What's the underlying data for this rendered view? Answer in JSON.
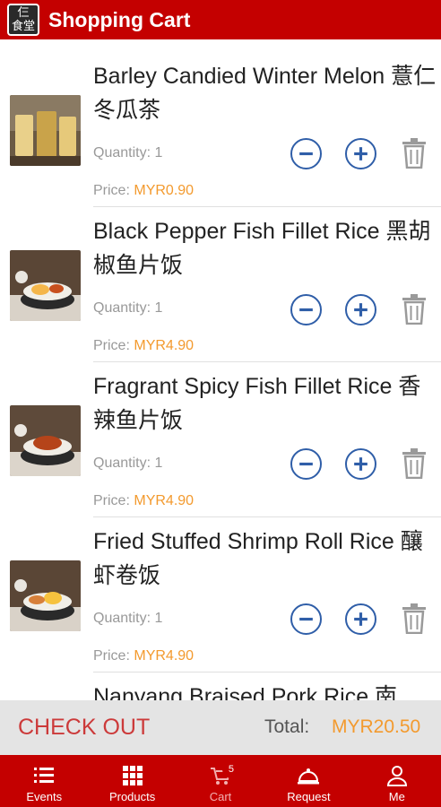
{
  "header": {
    "title": "Shopping Cart",
    "logo_text_top": "仨",
    "logo_text_bottom": "食堂"
  },
  "items": [
    {
      "name": "Barley Candied Winter Melon 薏仁冬瓜茶",
      "quantity": "Quantity: 1",
      "price_label": "Price:",
      "price": "MYR0.90"
    },
    {
      "name": "Black Pepper Fish Fillet Rice 黑胡椒鱼片饭",
      "quantity": "Quantity: 1",
      "price_label": "Price:",
      "price": "MYR4.90"
    },
    {
      "name": "Fragrant Spicy Fish Fillet Rice 香辣鱼片饭",
      "quantity": "Quantity: 1",
      "price_label": "Price:",
      "price": "MYR4.90"
    },
    {
      "name": "Fried Stuffed Shrimp Roll Rice 釀虾卷饭",
      "quantity": "Quantity: 1",
      "price_label": "Price:",
      "price": "MYR4.90"
    },
    {
      "name": "Nanyang Braised Pork Rice 南",
      "quantity": "",
      "price_label": "",
      "price": ""
    }
  ],
  "checkout": {
    "label": "CHECK OUT",
    "total_label": "Total:",
    "total": "MYR20.50"
  },
  "tabs": [
    {
      "label": "Events",
      "icon": "list-icon"
    },
    {
      "label": "Products",
      "icon": "grid-icon"
    },
    {
      "label": "Cart",
      "icon": "cart-icon",
      "badge": "5",
      "active": true
    },
    {
      "label": "Request",
      "icon": "cloche-icon"
    },
    {
      "label": "Me",
      "icon": "person-icon"
    }
  ],
  "colors": {
    "brand": "#c40000",
    "accent_price": "#f39a2e",
    "button_blue": "#2f5ea8",
    "checkout_text": "#cc3a3a"
  }
}
